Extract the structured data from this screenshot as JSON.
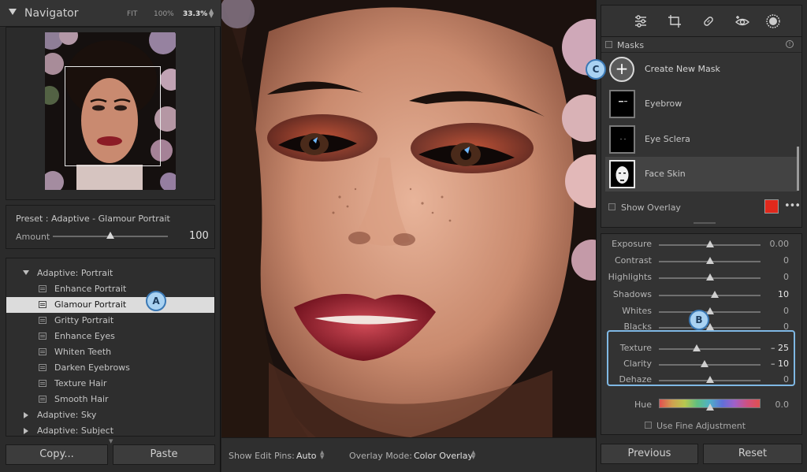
{
  "navigator": {
    "title": "Navigator",
    "zoom_options": [
      "FIT",
      "100%",
      "33.3%"
    ],
    "active_zoom": "33.3%"
  },
  "preset": {
    "name": "Preset : Adaptive - Glamour Portrait",
    "amount_label": "Amount",
    "amount_value": "100",
    "amount_fraction": 0.55
  },
  "preset_list": {
    "rows": [
      {
        "type": "group",
        "label": "Adaptive: Portrait",
        "expanded": true
      },
      {
        "type": "item",
        "label": "Enhance Portrait"
      },
      {
        "type": "item",
        "label": "Glamour Portrait",
        "selected": true
      },
      {
        "type": "item",
        "label": "Gritty Portrait"
      },
      {
        "type": "item",
        "label": "Enhance Eyes"
      },
      {
        "type": "item",
        "label": "Whiten Teeth"
      },
      {
        "type": "item",
        "label": "Darken Eyebrows"
      },
      {
        "type": "item",
        "label": "Texture Hair"
      },
      {
        "type": "item",
        "label": "Smooth Hair"
      },
      {
        "type": "group",
        "label": "Adaptive: Sky",
        "expanded": false
      },
      {
        "type": "group",
        "label": "Adaptive: Subject",
        "expanded": false
      }
    ]
  },
  "buttons": {
    "copy": "Copy...",
    "paste": "Paste",
    "previous": "Previous",
    "reset": "Reset"
  },
  "toolbar": {
    "show_edit_pins_label": "Show Edit Pins:",
    "show_edit_pins_value": "Auto",
    "overlay_mode_label": "Overlay Mode:",
    "overlay_mode_value": "Color Overlay"
  },
  "tools": [
    "sliders-icon",
    "crop-icon",
    "healing-icon",
    "red-eye-icon",
    "masking-icon"
  ],
  "masks": {
    "header": "Masks",
    "create_label": "Create New Mask",
    "items": [
      {
        "label": "Eyebrow",
        "selected": false
      },
      {
        "label": "Eye Sclera",
        "selected": false
      },
      {
        "label": "Face Skin",
        "selected": true
      }
    ],
    "show_overlay_label": "Show Overlay",
    "overlay_color": "#e0281c"
  },
  "adjustments": {
    "sliders": [
      {
        "label": "Exposure",
        "value": "0.00",
        "position": 0.5
      },
      {
        "label": "Contrast",
        "value": "0",
        "position": 0.5
      },
      {
        "label": "Highlights",
        "value": "0",
        "position": 0.5
      },
      {
        "label": "Shadows",
        "value": "10",
        "position": 0.55,
        "changed": true
      },
      {
        "label": "Whites",
        "value": "0",
        "position": 0.5
      },
      {
        "label": "Blacks",
        "value": "0",
        "position": 0.5
      },
      {
        "label": "Texture",
        "value": "– 25",
        "position": 0.375,
        "changed": true
      },
      {
        "label": "Clarity",
        "value": "– 10",
        "position": 0.45,
        "changed": true
      },
      {
        "label": "Dehaze",
        "value": "0",
        "position": 0.5
      }
    ],
    "hue_label": "Hue",
    "hue_value": "0.0",
    "hue_position": 0.5,
    "fine_adjust_label": "Use Fine Adjustment"
  },
  "callouts": {
    "a": "A",
    "b": "B",
    "c": "C"
  },
  "colors": {
    "callout_fill": "#a9d2f2",
    "callout_border": "#3b79b5",
    "selected_row": "#dcdcdc"
  }
}
